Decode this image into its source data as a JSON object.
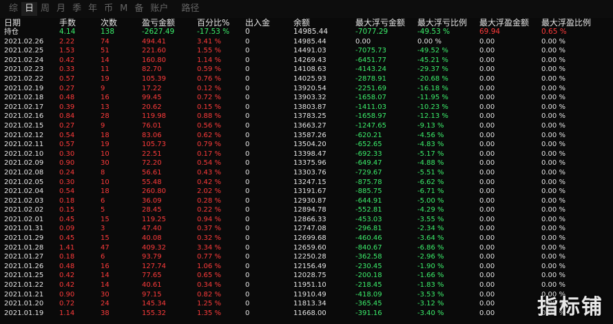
{
  "tabs": [
    {
      "label": "综",
      "active": false
    },
    {
      "label": "日",
      "active": true
    },
    {
      "label": "周",
      "active": false
    },
    {
      "label": "月",
      "active": false
    },
    {
      "label": "季",
      "active": false
    },
    {
      "label": "年",
      "active": false
    },
    {
      "label": "币",
      "active": false
    },
    {
      "label": "M",
      "active": false
    },
    {
      "label": "备",
      "active": false
    },
    {
      "label": "账户",
      "active": false
    },
    {
      "label": "路径",
      "active": false,
      "sep": true
    }
  ],
  "columns": [
    "日期",
    "手数",
    "次数",
    "盈亏金额",
    "百分比%",
    "出入金",
    "余额",
    "最大浮亏金额",
    "最大浮亏比例",
    "最大浮盈金额",
    "最大浮盈比例"
  ],
  "position_row": {
    "label": "持仓",
    "lots": "4.14",
    "count": "138",
    "pnl": "-2627.49",
    "pct": "-17.53 %",
    "inout": "0",
    "balance": "14985.44",
    "max_float_loss": "-7077.29",
    "max_float_loss_pct": "-49.53 %",
    "max_float_profit": "69.94",
    "max_float_profit_pct": "0.65 %"
  },
  "rows": [
    [
      "2021.02.26",
      "2.22",
      "74",
      "494.41",
      "3.41 %",
      "0",
      "14985.44",
      "0.00",
      "0.00 %",
      "0.00",
      "0.00 %"
    ],
    [
      "2021.02.25",
      "1.53",
      "51",
      "221.60",
      "1.55 %",
      "0",
      "14491.03",
      "-7075.73",
      "-49.52 %",
      "0.00",
      "0.00 %"
    ],
    [
      "2021.02.24",
      "0.42",
      "14",
      "160.80",
      "1.14 %",
      "0",
      "14269.43",
      "-6451.77",
      "-45.21 %",
      "0.00",
      "0.00 %"
    ],
    [
      "2021.02.23",
      "0.33",
      "11",
      "82.70",
      "0.59 %",
      "0",
      "14108.63",
      "-4143.24",
      "-29.37 %",
      "0.00",
      "0.00 %"
    ],
    [
      "2021.02.22",
      "0.57",
      "19",
      "105.39",
      "0.76 %",
      "0",
      "14025.93",
      "-2878.91",
      "-20.68 %",
      "0.00",
      "0.00 %"
    ],
    [
      "2021.02.19",
      "0.27",
      "9",
      "17.22",
      "0.12 %",
      "0",
      "13920.54",
      "-2251.69",
      "-16.18 %",
      "0.00",
      "0.00 %"
    ],
    [
      "2021.02.18",
      "0.48",
      "16",
      "99.45",
      "0.72 %",
      "0",
      "13903.32",
      "-1658.07",
      "-11.95 %",
      "0.00",
      "0.00 %"
    ],
    [
      "2021.02.17",
      "0.39",
      "13",
      "20.62",
      "0.15 %",
      "0",
      "13803.87",
      "-1411.03",
      "-10.23 %",
      "0.00",
      "0.00 %"
    ],
    [
      "2021.02.16",
      "0.84",
      "28",
      "119.98",
      "0.88 %",
      "0",
      "13783.25",
      "-1658.97",
      "-12.13 %",
      "0.00",
      "0.00 %"
    ],
    [
      "2021.02.15",
      "0.27",
      "9",
      "76.01",
      "0.56 %",
      "0",
      "13663.27",
      "-1247.65",
      "-9.13 %",
      "0.00",
      "0.00 %"
    ],
    [
      "2021.02.12",
      "0.54",
      "18",
      "83.06",
      "0.62 %",
      "0",
      "13587.26",
      "-620.21",
      "-4.56 %",
      "0.00",
      "0.00 %"
    ],
    [
      "2021.02.11",
      "0.57",
      "19",
      "105.73",
      "0.79 %",
      "0",
      "13504.20",
      "-652.65",
      "-4.83 %",
      "0.00",
      "0.00 %"
    ],
    [
      "2021.02.10",
      "0.30",
      "10",
      "22.51",
      "0.17 %",
      "0",
      "13398.47",
      "-692.33",
      "-5.17 %",
      "0.00",
      "0.00 %"
    ],
    [
      "2021.02.09",
      "0.90",
      "30",
      "72.20",
      "0.54 %",
      "0",
      "13375.96",
      "-649.47",
      "-4.88 %",
      "0.00",
      "0.00 %"
    ],
    [
      "2021.02.08",
      "0.24",
      "8",
      "56.61",
      "0.43 %",
      "0",
      "13303.76",
      "-729.67",
      "-5.51 %",
      "0.00",
      "0.00 %"
    ],
    [
      "2021.02.05",
      "0.30",
      "10",
      "55.48",
      "0.42 %",
      "0",
      "13247.15",
      "-875.78",
      "-6.62 %",
      "0.00",
      "0.00 %"
    ],
    [
      "2021.02.04",
      "0.54",
      "18",
      "260.80",
      "2.02 %",
      "0",
      "13191.67",
      "-885.75",
      "-6.71 %",
      "0.00",
      "0.00 %"
    ],
    [
      "2021.02.03",
      "0.18",
      "6",
      "36.09",
      "0.28 %",
      "0",
      "12930.87",
      "-644.91",
      "-5.00 %",
      "0.00",
      "0.00 %"
    ],
    [
      "2021.02.02",
      "0.15",
      "5",
      "28.45",
      "0.22 %",
      "0",
      "12894.78",
      "-552.81",
      "-4.29 %",
      "0.00",
      "0.00 %"
    ],
    [
      "2021.02.01",
      "0.45",
      "15",
      "119.25",
      "0.94 %",
      "0",
      "12866.33",
      "-453.03",
      "-3.55 %",
      "0.00",
      "0.00 %"
    ],
    [
      "2021.01.31",
      "0.09",
      "3",
      "47.40",
      "0.37 %",
      "0",
      "12747.08",
      "-296.81",
      "-2.34 %",
      "0.00",
      "0.00 %"
    ],
    [
      "2021.01.29",
      "0.45",
      "15",
      "40.08",
      "0.32 %",
      "0",
      "12699.68",
      "-460.46",
      "-3.64 %",
      "0.00",
      "0.00 %"
    ],
    [
      "2021.01.28",
      "1.41",
      "47",
      "409.32",
      "3.34 %",
      "0",
      "12659.60",
      "-840.67",
      "-6.86 %",
      "0.00",
      "0.00 %"
    ],
    [
      "2021.01.27",
      "0.18",
      "6",
      "93.79",
      "0.77 %",
      "0",
      "12250.28",
      "-362.58",
      "-2.96 %",
      "0.00",
      "0.00 %"
    ],
    [
      "2021.01.26",
      "0.48",
      "16",
      "127.74",
      "1.06 %",
      "0",
      "12156.49",
      "-230.45",
      "-1.90 %",
      "0.00",
      "0.00 %"
    ],
    [
      "2021.01.25",
      "0.42",
      "14",
      "77.65",
      "0.65 %",
      "0",
      "12028.75",
      "-200.18",
      "-1.66 %",
      "0.00",
      "0.00 %"
    ],
    [
      "2021.01.22",
      "0.42",
      "14",
      "40.61",
      "0.34 %",
      "0",
      "11951.10",
      "-218.45",
      "-1.83 %",
      "0.00",
      "0.00 %"
    ],
    [
      "2021.01.21",
      "0.90",
      "30",
      "97.15",
      "0.82 %",
      "0",
      "11910.49",
      "-418.09",
      "-3.53 %",
      "0.00",
      "0.00 %"
    ],
    [
      "2021.01.20",
      "0.72",
      "24",
      "145.34",
      "1.25 %",
      "0",
      "11813.34",
      "-365.45",
      "-3.12 %",
      "0.00",
      "0.00 %"
    ],
    [
      "2021.01.19",
      "1.14",
      "38",
      "155.32",
      "1.35 %",
      "0",
      "11668.00",
      "-391.16",
      "-3.40 %",
      "0.00",
      "0.00 %"
    ]
  ],
  "watermark": "指标铺",
  "colors": {
    "background": "#0a0a0a",
    "text": "#e6e6e6",
    "positive": "#ff3b3b",
    "negative": "#3cf06c"
  }
}
